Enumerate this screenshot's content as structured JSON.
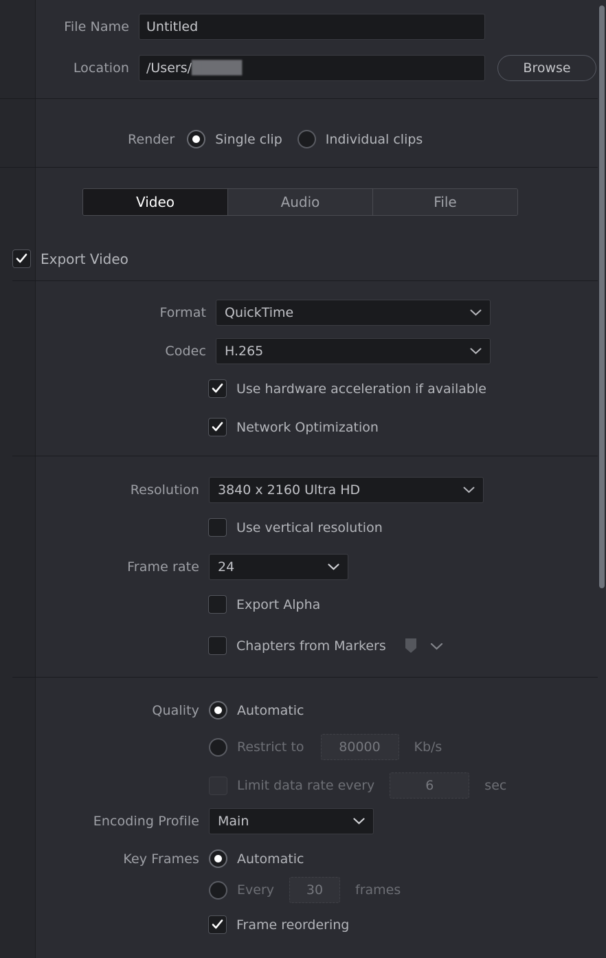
{
  "file": {
    "name_label": "File Name",
    "name_value": "Untitled",
    "location_label": "Location",
    "location_value": "/Users/",
    "location_redacted": "█████",
    "browse_label": "Browse"
  },
  "render": {
    "label": "Render",
    "options": [
      {
        "label": "Single clip",
        "selected": true
      },
      {
        "label": "Individual clips",
        "selected": false
      }
    ]
  },
  "tabs": [
    {
      "label": "Video",
      "active": true
    },
    {
      "label": "Audio",
      "active": false
    },
    {
      "label": "File",
      "active": false
    }
  ],
  "export_video": {
    "label": "Export Video",
    "checked": true
  },
  "video": {
    "format_label": "Format",
    "format_value": "QuickTime",
    "codec_label": "Codec",
    "codec_value": "H.265",
    "hw_accel_label": "Use hardware acceleration if available",
    "hw_accel_checked": true,
    "network_opt_label": "Network Optimization",
    "network_opt_checked": true,
    "resolution_label": "Resolution",
    "resolution_value": "3840 x 2160 Ultra HD",
    "vertical_res_label": "Use vertical resolution",
    "vertical_res_checked": false,
    "frame_rate_label": "Frame rate",
    "frame_rate_value": "24",
    "export_alpha_label": "Export Alpha",
    "export_alpha_checked": false,
    "chapters_label": "Chapters from Markers",
    "chapters_checked": false
  },
  "quality": {
    "label": "Quality",
    "automatic_label": "Automatic",
    "automatic_selected": true,
    "restrict_label": "Restrict to",
    "restrict_selected": false,
    "restrict_value": "80000",
    "restrict_unit": "Kb/s",
    "limit_label": "Limit data rate every",
    "limit_checked": false,
    "limit_value": "6",
    "limit_unit": "sec"
  },
  "encoding": {
    "profile_label": "Encoding Profile",
    "profile_value": "Main"
  },
  "keyframes": {
    "label": "Key Frames",
    "automatic_label": "Automatic",
    "automatic_selected": true,
    "every_label": "Every",
    "every_selected": false,
    "every_value": "30",
    "every_unit": "frames",
    "reordering_label": "Frame reordering",
    "reordering_checked": true
  },
  "colors": {
    "panel_bg": "#2b2c32",
    "field_bg": "#191a1d",
    "text": "#b6b8bd",
    "text_dim": "#76787e",
    "active_tab_bg": "#19191c",
    "scrollbar": "#6f747c"
  }
}
